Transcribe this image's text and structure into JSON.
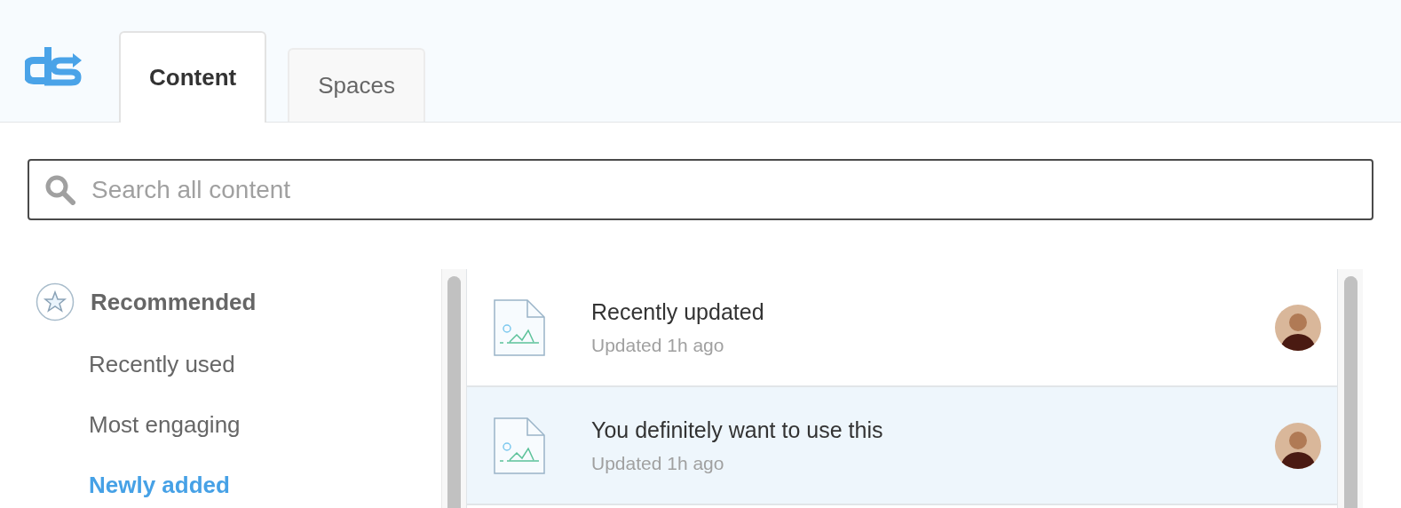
{
  "tabs": [
    {
      "label": "Content",
      "selected": true
    },
    {
      "label": "Spaces",
      "selected": false
    }
  ],
  "search": {
    "placeholder": "Search all content"
  },
  "sidebar": {
    "heading": "Recommended",
    "items": [
      {
        "label": "Recently used",
        "selected": false
      },
      {
        "label": "Most engaging",
        "selected": false
      },
      {
        "label": "Newly added",
        "selected": true
      }
    ]
  },
  "content_list": [
    {
      "title": "Recently updated",
      "subtitle": "Updated 1h ago",
      "selected": false
    },
    {
      "title": "You definitely want to use this",
      "subtitle": "Updated 1h ago",
      "selected": true
    }
  ]
}
